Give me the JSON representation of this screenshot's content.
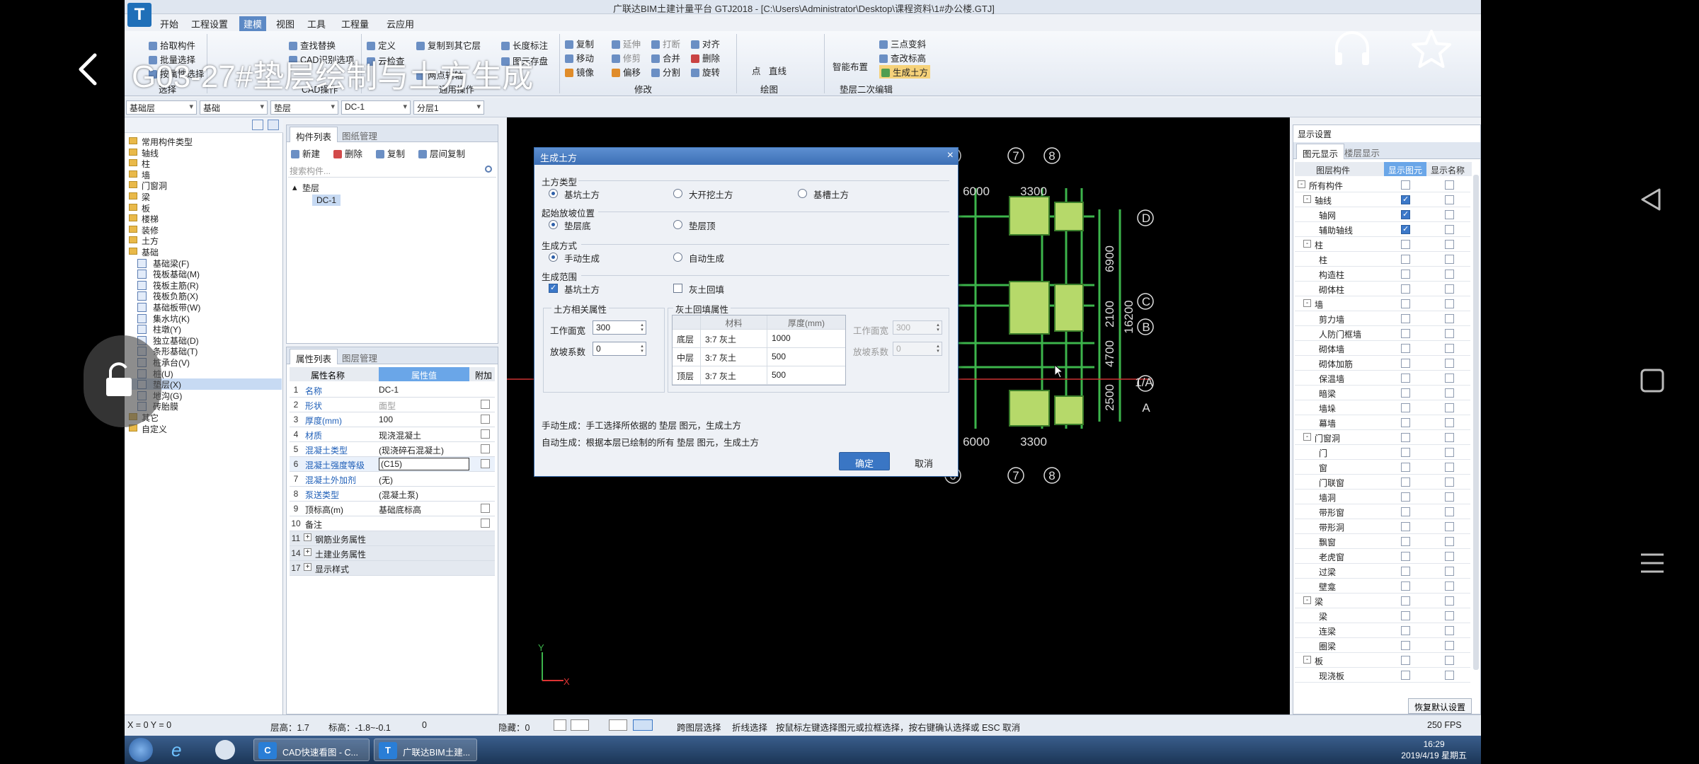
{
  "video_overlay": {
    "title": "G03-27#垫层绘制与土方生成"
  },
  "window": {
    "title": "广联达BIM土建计量平台 GTJ2018 - [C:\\Users\\Administrator\\Desktop\\课程资料\\1#办公楼.GTJ]",
    "logo": "T",
    "menus": [
      "开始",
      "工程设置",
      "建模",
      "视图",
      "工具",
      "工程量",
      "云应用"
    ],
    "active_menu": "建模"
  },
  "ribbon": {
    "select": {
      "items": [
        "拾取构件",
        "批量选择",
        "按属性选择"
      ],
      "label": "选择"
    },
    "cad": {
      "items": [
        "查找替换",
        "CAD识别选项"
      ],
      "label": "CAD操作"
    },
    "common": {
      "items": [
        "定义",
        "复制到其它层",
        "长度标注",
        "云检查",
        "图元存盘",
        "两点辅轴"
      ],
      "label": "通用操作"
    },
    "modify": {
      "items": [
        "复制",
        "延伸",
        "打断",
        "对齐",
        "移动",
        "修剪",
        "合并",
        "删除",
        "镜像",
        "偏移",
        "分割",
        "旋转"
      ],
      "label": "修改"
    },
    "draw": {
      "items": [
        "点",
        "直线"
      ],
      "label": "绘图"
    },
    "secondary": {
      "items": [
        "智能布置",
        "三点变斜",
        "查改标高",
        "生成土方"
      ],
      "label": "垫层二次编辑"
    }
  },
  "filters": [
    "基础层",
    "基础",
    "垫层",
    "DC-1",
    "分层1"
  ],
  "tree": {
    "items": [
      {
        "label": "常用构件类型",
        "level": 0
      },
      {
        "label": "轴线",
        "level": 0
      },
      {
        "label": "柱",
        "level": 0
      },
      {
        "label": "墙",
        "level": 0
      },
      {
        "label": "门窗洞",
        "level": 0
      },
      {
        "label": "梁",
        "level": 0
      },
      {
        "label": "板",
        "level": 0
      },
      {
        "label": "楼梯",
        "level": 0
      },
      {
        "label": "装修",
        "level": 0
      },
      {
        "label": "土方",
        "level": 0
      },
      {
        "label": "基础",
        "level": 0
      },
      {
        "label": "基础梁(F)",
        "level": 1
      },
      {
        "label": "筏板基础(M)",
        "level": 1
      },
      {
        "label": "筏板主筋(R)",
        "level": 1
      },
      {
        "label": "筏板负筋(X)",
        "level": 1
      },
      {
        "label": "基础板带(W)",
        "level": 1
      },
      {
        "label": "集水坑(K)",
        "level": 1
      },
      {
        "label": "柱墩(Y)",
        "level": 1
      },
      {
        "label": "独立基础(D)",
        "level": 1
      },
      {
        "label": "条形基础(T)",
        "level": 1
      },
      {
        "label": "桩承台(V)",
        "level": 1
      },
      {
        "label": "桩(U)",
        "level": 1
      },
      {
        "label": "垫层(X)",
        "level": 1,
        "selected": true
      },
      {
        "label": "地沟(G)",
        "level": 1
      },
      {
        "label": "砖胎膜",
        "level": 1
      },
      {
        "label": "其它",
        "level": 0
      },
      {
        "label": "自定义",
        "level": 0
      }
    ]
  },
  "component_list": {
    "tabs": [
      "构件列表",
      "图纸管理"
    ],
    "toolbar": [
      "新建",
      "删除",
      "复制",
      "层间复制"
    ],
    "search_placeholder": "搜索构件...",
    "group": "垫层",
    "item": "DC-1"
  },
  "properties": {
    "tabs": [
      "属性列表",
      "图层管理"
    ],
    "headers": [
      "属性名称",
      "属性值",
      "附加"
    ],
    "rows": [
      {
        "n": "1",
        "k": "名称",
        "v": "DC-1",
        "blue": true,
        "cb": false
      },
      {
        "n": "2",
        "k": "形状",
        "v": "面型",
        "blue": true,
        "gray": true,
        "cb": true
      },
      {
        "n": "3",
        "k": "厚度(mm)",
        "v": "100",
        "blue": true,
        "cb": true
      },
      {
        "n": "4",
        "k": "材质",
        "v": "现浇混凝土",
        "blue": true,
        "cb": true
      },
      {
        "n": "5",
        "k": "混凝土类型",
        "v": "(现浇碎石混凝土)",
        "blue": true,
        "cb": true
      },
      {
        "n": "6",
        "k": "混凝土强度等级",
        "v": "(C15)",
        "blue": true,
        "cb": true,
        "hl": true
      },
      {
        "n": "7",
        "k": "混凝土外加剂",
        "v": "(无)",
        "blue": true,
        "cb": false
      },
      {
        "n": "8",
        "k": "泵送类型",
        "v": "(混凝土泵)",
        "blue": true,
        "cb": false
      },
      {
        "n": "9",
        "k": "顶标高(m)",
        "v": "基础底标高",
        "blue": false,
        "cb": true
      },
      {
        "n": "10",
        "k": "备注",
        "v": "",
        "blue": false,
        "cb": true
      },
      {
        "n": "11",
        "k": "钢筋业务属性",
        "v": "",
        "grp": true
      },
      {
        "n": "14",
        "k": "土建业务属性",
        "v": "",
        "grp": true
      },
      {
        "n": "17",
        "k": "显示样式",
        "v": "",
        "grp": true
      }
    ]
  },
  "dialog": {
    "title": "生成土方",
    "sections": {
      "earth_type": "土方类型",
      "slope_start": "起始放坡位置",
      "method": "生成方式",
      "range": "生成范围",
      "earth_props": "土方相关属性",
      "lime_props": "灰土回填属性"
    },
    "earth_type_options": [
      "基坑土方",
      "大开挖土方",
      "基槽土方"
    ],
    "slope_options": [
      "垫层底",
      "垫层顶"
    ],
    "method_options": [
      "手动生成",
      "自动生成"
    ],
    "range_options": [
      "基坑土方",
      "灰土回填"
    ],
    "work_width_label": "工作面宽",
    "work_width": "300",
    "slope_coef_label": "放坡系数",
    "slope_coef": "0",
    "lime_work_width": "300",
    "lime_slope_coef": "0",
    "lime_table": {
      "headers": [
        "材料",
        "厚度(mm)"
      ],
      "rows": [
        {
          "name": "底层",
          "material": "3:7 灰土",
          "thickness": "1000"
        },
        {
          "name": "中层",
          "material": "3:7 灰土",
          "thickness": "500"
        },
        {
          "name": "顶层",
          "material": "3:7 灰土",
          "thickness": "500"
        }
      ]
    },
    "note1": "手动生成：手工选择所依据的 垫层 图元，生成土方",
    "note2": "自动生成：根据本层已绘制的所有 垫层 图元，生成土方",
    "ok": "确定",
    "cancel": "取消"
  },
  "drawing": {
    "axes_top": [
      "6",
      "7",
      "8"
    ],
    "axes_bottom": [
      "6",
      "7",
      "8"
    ],
    "axes_right": [
      "D",
      "C",
      "B",
      "1/A",
      "A"
    ],
    "dims_top": [
      "6000",
      "3300"
    ],
    "dims_bottom": [
      "6000",
      "3300"
    ],
    "dims_right": [
      "6900",
      "2100",
      "4700",
      "2500"
    ],
    "total_right": "16200",
    "ucs_x": "X",
    "ucs_y": "Y"
  },
  "display_settings": {
    "title": "显示设置",
    "tabs": [
      "图元显示",
      "楼层显示"
    ],
    "headers": [
      "图层构件",
      "显示图元",
      "显示名称"
    ],
    "rows": [
      {
        "label": "所有构件",
        "level": 0,
        "exp": "-",
        "c1": false
      },
      {
        "label": "轴线",
        "level": 1,
        "exp": "-",
        "c1": true
      },
      {
        "label": "轴网",
        "level": 2,
        "c1": true
      },
      {
        "label": "辅助轴线",
        "level": 2,
        "c1": true
      },
      {
        "label": "柱",
        "level": 1,
        "exp": "-",
        "c1": false
      },
      {
        "label": "柱",
        "level": 2,
        "c1": false
      },
      {
        "label": "构造柱",
        "level": 2,
        "c1": false
      },
      {
        "label": "砌体柱",
        "level": 2,
        "c1": false
      },
      {
        "label": "墙",
        "level": 1,
        "exp": "-",
        "c1": false
      },
      {
        "label": "剪力墙",
        "level": 2,
        "c1": false
      },
      {
        "label": "人防门框墙",
        "level": 2,
        "c1": false
      },
      {
        "label": "砌体墙",
        "level": 2,
        "c1": false
      },
      {
        "label": "砌体加筋",
        "level": 2,
        "c1": false
      },
      {
        "label": "保温墙",
        "level": 2,
        "c1": false
      },
      {
        "label": "暗梁",
        "level": 2,
        "c1": false
      },
      {
        "label": "墙垛",
        "level": 2,
        "c1": false
      },
      {
        "label": "幕墙",
        "level": 2,
        "c1": false
      },
      {
        "label": "门窗洞",
        "level": 1,
        "exp": "-",
        "c1": false
      },
      {
        "label": "门",
        "level": 2,
        "c1": false
      },
      {
        "label": "窗",
        "level": 2,
        "c1": false
      },
      {
        "label": "门联窗",
        "level": 2,
        "c1": false
      },
      {
        "label": "墙洞",
        "level": 2,
        "c1": false
      },
      {
        "label": "带形窗",
        "level": 2,
        "c1": false
      },
      {
        "label": "带形洞",
        "level": 2,
        "c1": false
      },
      {
        "label": "飘窗",
        "level": 2,
        "c1": false
      },
      {
        "label": "老虎窗",
        "level": 2,
        "c1": false
      },
      {
        "label": "过梁",
        "level": 2,
        "c1": false
      },
      {
        "label": "壁龛",
        "level": 2,
        "c1": false
      },
      {
        "label": "梁",
        "level": 1,
        "exp": "-",
        "c1": false
      },
      {
        "label": "梁",
        "level": 2,
        "c1": false
      },
      {
        "label": "连梁",
        "level": 2,
        "c1": false
      },
      {
        "label": "圈梁",
        "level": 2,
        "c1": false
      },
      {
        "label": "板",
        "level": 1,
        "exp": "-",
        "c1": false
      },
      {
        "label": "现浇板",
        "level": 2,
        "c1": false
      }
    ],
    "restore": "恢复默认设置"
  },
  "statusbar": {
    "coords": "X = 0 Y = 0",
    "floor_height": "层高：1.7",
    "elevation": "标高：-1.8~-0.1",
    "zero": "0",
    "hidden": "隐藏：0",
    "cross_select": "跨图层选择",
    "polyline_select": "折线选择",
    "hint": "按鼠标左键选择图元或拉框选择，按右键确认选择或 ESC 取消",
    "fps": "250 FPS"
  },
  "taskbar": {
    "tasks": [
      "CAD快速看图 - C...",
      "广联达BIM土建..."
    ],
    "time": "16:29",
    "date": "2019/4/19 星期五"
  }
}
